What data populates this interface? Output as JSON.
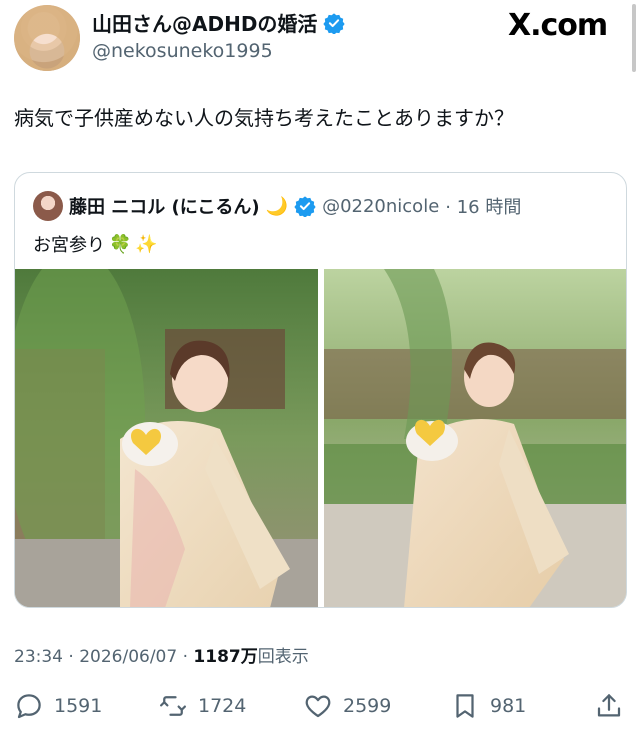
{
  "header": {
    "display_name": "山田さん@ADHDの婚活",
    "handle": "@nekosuneko1995",
    "site_logo": "X.com"
  },
  "tweet": {
    "text": "病気で子供産めない人の気持ち考えたことありますか？"
  },
  "quote": {
    "display_name": "藤田 ニコル (にこるん)",
    "emoji_moon": "🌙",
    "handle": "@0220nicole",
    "time": "· 16 時間",
    "text": "お宮参り",
    "emoji_clover": "🍀",
    "emoji_sparkles": "✨"
  },
  "meta": {
    "time_date": "23:34 · 2026/06/07 · ",
    "views_count": "1187万",
    "views_label": "回表示"
  },
  "actions": {
    "replies": "1591",
    "reposts": "1724",
    "likes": "2599",
    "bookmarks": "981"
  },
  "colors": {
    "verified_blue": "#1d9bf0",
    "text_primary": "#0f1419",
    "text_secondary": "#536471",
    "border": "#cfd9de"
  },
  "icons": [
    "verified-badge-icon",
    "reply-icon",
    "repost-icon",
    "like-icon",
    "bookmark-icon",
    "share-icon"
  ]
}
